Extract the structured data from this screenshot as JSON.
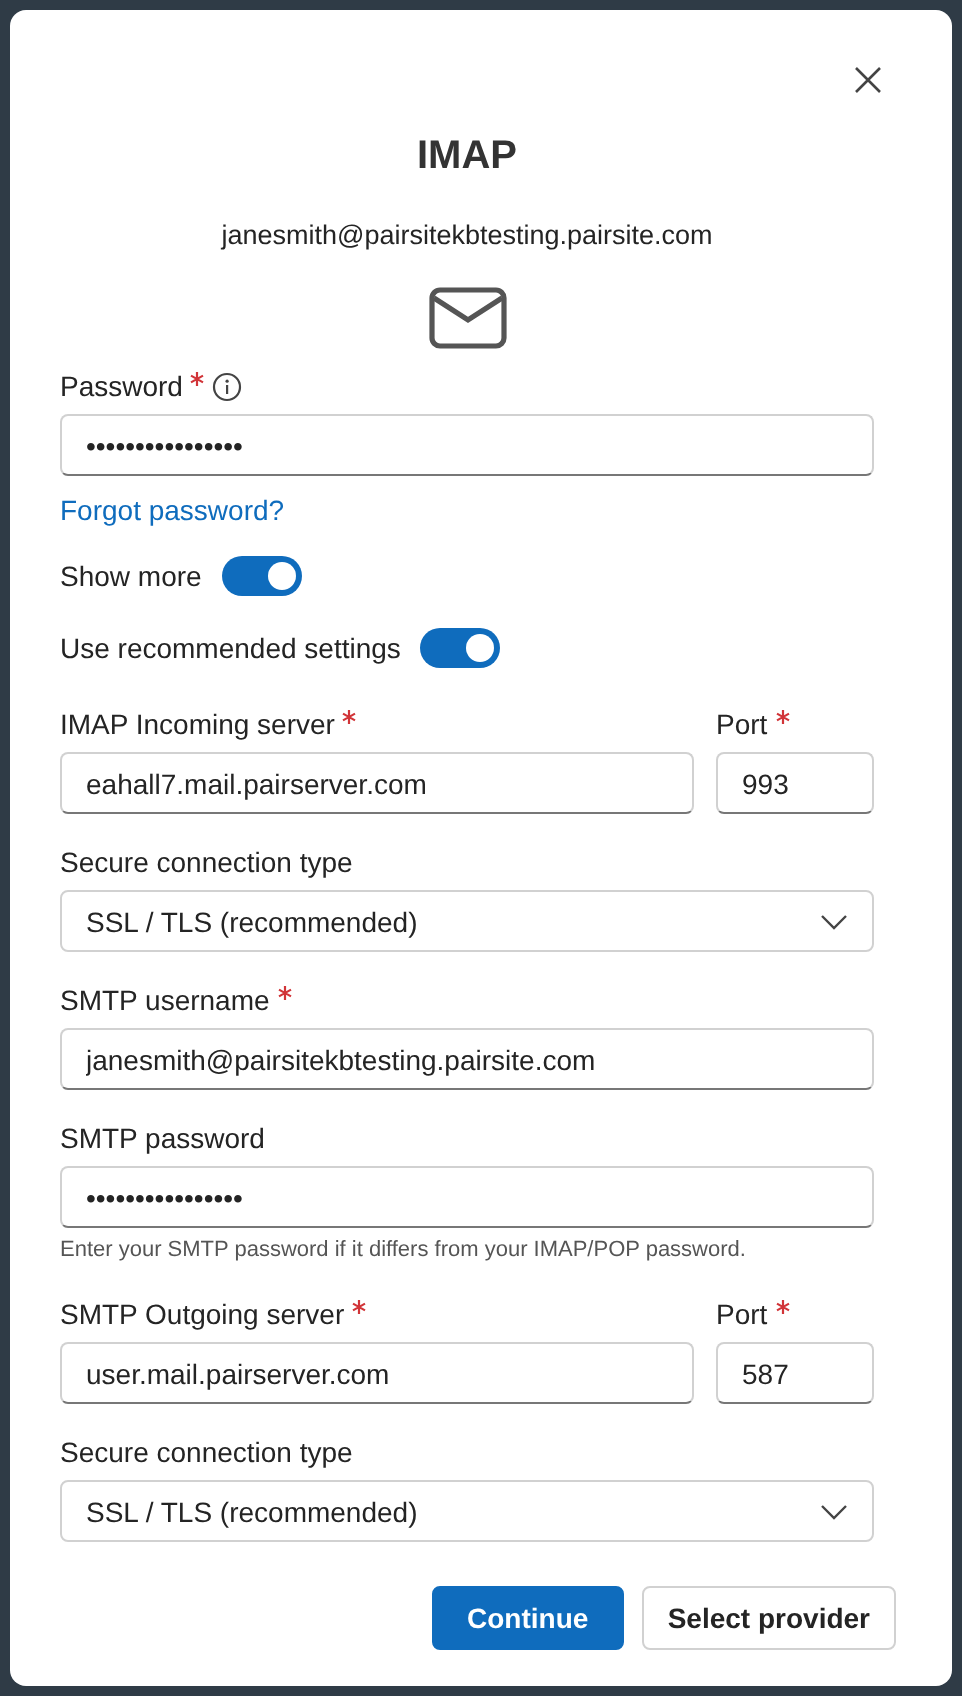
{
  "title": "IMAP",
  "email": "janesmith@pairsitekbtesting.pairsite.com",
  "password": {
    "label": "Password",
    "required": true,
    "info": true,
    "value": "••••••••••••••••"
  },
  "forgot_link": "Forgot password?",
  "toggles": [
    {
      "label": "Show more",
      "on": true
    },
    {
      "label": "Use recommended settings",
      "on": true
    }
  ],
  "fields": [
    {
      "kind": "server",
      "label": "IMAP Incoming server",
      "required": true,
      "value": "eahall7.mail.pairserver.com",
      "port": {
        "label": "Port",
        "required": true,
        "value": "993"
      }
    },
    {
      "kind": "select",
      "label": "Secure connection type",
      "required": false,
      "value": "SSL / TLS (recommended)"
    },
    {
      "kind": "text",
      "label": "SMTP username",
      "required": true,
      "value": "janesmith@pairsitekbtesting.pairsite.com"
    },
    {
      "kind": "text",
      "label": "SMTP password",
      "required": false,
      "value": "••••••••••••••••",
      "hint": "Enter your SMTP password if it differs from your IMAP/POP password."
    },
    {
      "kind": "server",
      "label": "SMTP Outgoing server",
      "required": true,
      "value": "user.mail.pairserver.com",
      "port": {
        "label": "Port",
        "required": true,
        "value": "587"
      }
    },
    {
      "kind": "select",
      "label": "Secure connection type",
      "required": false,
      "value": "SSL / TLS (recommended)"
    }
  ],
  "buttons": [
    {
      "label": "Continue",
      "primary": true
    },
    {
      "label": "Select provider",
      "primary": false
    }
  ]
}
